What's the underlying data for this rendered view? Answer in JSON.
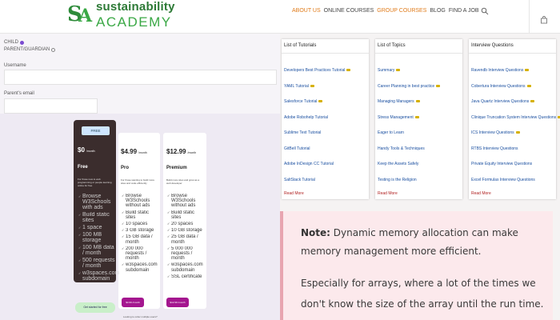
{
  "header": {
    "logo_line1": "sustainability",
    "logo_line2": "ACADEMY",
    "nav": [
      {
        "label": "ABOUT US",
        "active": true
      },
      {
        "label": "ONLINE COURSES",
        "active": false
      },
      {
        "label": "GROUP COURSES",
        "active": true
      },
      {
        "label": "BLOG",
        "active": false
      },
      {
        "label": "FIND A JOB",
        "active": false
      }
    ],
    "accent_color": "#e07b1a"
  },
  "form": {
    "radio_child": "CHILD",
    "radio_parent": "PARENT/GUARDIAN",
    "username_label": "Username",
    "parent_email_label": "Parent's email"
  },
  "pricing": {
    "free": {
      "badge": "FREE",
      "price": "$0",
      "period": "/month",
      "name": "Free",
      "desc": "For those new to web programming or people learning online for free",
      "features": [
        "Browse W3Schools with ads",
        "Build static sites",
        "1 space",
        "100 MB storage",
        "100 MB data / month",
        "500 requests / month",
        "w3spaces.com subdomain"
      ],
      "button": "Get started for free"
    },
    "pro": {
      "price": "$4.99",
      "period": "/month",
      "name": "Pro",
      "desc": "For those wanting to build more sites and code efficiently",
      "features": [
        "Browse W3Schools without ads",
        "Build static sites",
        "10 spaces",
        "3 GB storage",
        "15 GB data / month",
        "200 000 requests / month",
        "w3spaces.com subdomain"
      ],
      "button": "$4.99 /month"
    },
    "premium": {
      "price": "$12.99",
      "period": "/month",
      "name": "Premium",
      "desc": "Build more sites and grow as a web developer",
      "features": [
        "Browse W3Schools without ads",
        "Build static sites",
        "20 spaces",
        "10 GB storage",
        "25 GB data / month",
        "5 000 000 requests / month",
        "w3spaces.com subdomain",
        "SSL certificate"
      ],
      "button": "$12.99 /month"
    },
    "footnote": "Looking to order multiple users?"
  },
  "tutorials": {
    "title": "List of Tutorials",
    "items": [
      "Developers Best Practices Tutorial",
      "YAML Tutorial",
      "Salesforce Tutorial",
      "Adobe Robohelp Tutorial",
      "Sublime Text Tutorial",
      "GitBell Tutorial",
      "Adobe InDesign CC Tutorial",
      "SaltStack Tutorial"
    ],
    "read_more": "Read More"
  },
  "topics": {
    "title": "List of Topics",
    "items": [
      "Summary",
      "Career Planning in best practice",
      "Managing Managers",
      "Stress Management",
      "Eager to Learn",
      "Handy Tools & Techniques",
      "Keep the Assets Safely",
      "Testing is the Religion"
    ],
    "read_more": "Read More"
  },
  "interview": {
    "title": "Interview Questions",
    "items": [
      "Ravendb Interview Questions",
      "Cobertura Interview Questions",
      "Java Quartz Interview Questions",
      "Clinique Truncation System Interview Questions",
      "ICS Interview Questions",
      "RTBS Interview Questions",
      "Private Equity Interview Questions",
      "Excel Formulas Interview Questions"
    ],
    "read_more": "Read More"
  },
  "note": {
    "label": "Note:",
    "text1": " Dynamic memory allocation can make memory management more efficient.",
    "text2": "Especially for arrays, where a lot of the times we don't know the size of the array until the run time."
  }
}
